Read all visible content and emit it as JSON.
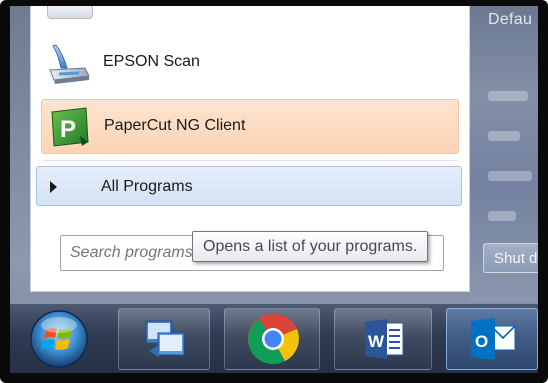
{
  "desktop_pane": {
    "default_text": "Defau",
    "shutdown_label": "Shut d"
  },
  "start_menu": {
    "programs": [
      {
        "label": "EPSON Scan",
        "icon": "epson-scan-icon"
      },
      {
        "label": "PaperCut NG Client",
        "icon": "papercut-icon"
      }
    ],
    "all_programs_label": "All Programs",
    "search_placeholder": "Search programs and files",
    "tooltip": "Opens a list of your programs."
  },
  "taskbar": {
    "items": [
      {
        "name": "start-button",
        "icon": "windows-orb-icon"
      },
      {
        "name": "remote-desktop",
        "icon": "remote-desktop-icon"
      },
      {
        "name": "chrome",
        "icon": "chrome-icon"
      },
      {
        "name": "word",
        "icon": "word-icon",
        "letter": "W"
      },
      {
        "name": "outlook",
        "icon": "outlook-icon",
        "letter": "O"
      }
    ]
  },
  "colors": {
    "highlight": "#fbd4b6",
    "all_programs_bg": "#d3e2f6",
    "taskbar": "#2f3b52"
  }
}
